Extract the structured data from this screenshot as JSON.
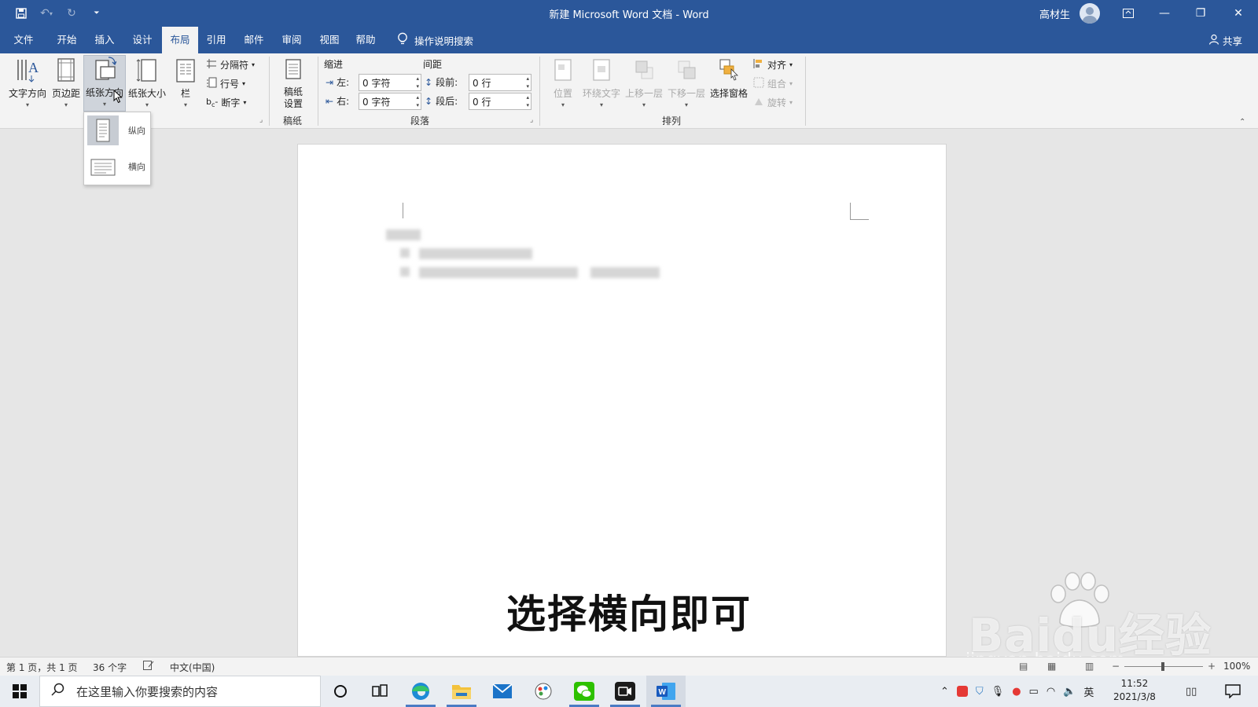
{
  "window": {
    "title": "新建 Microsoft Word 文档 - Word",
    "user_name": "高材生",
    "accent": "#2b579a"
  },
  "qat": {
    "save_icon": "save-icon",
    "undo_icon": "undo-icon",
    "redo_icon": "redo-icon",
    "customize_icon": "customize-qat-icon"
  },
  "tabs": [
    {
      "label": "文件"
    },
    {
      "label": "开始"
    },
    {
      "label": "插入"
    },
    {
      "label": "设计"
    },
    {
      "label": "布局",
      "active": true
    },
    {
      "label": "引用"
    },
    {
      "label": "邮件"
    },
    {
      "label": "审阅"
    },
    {
      "label": "视图"
    },
    {
      "label": "帮助"
    }
  ],
  "tell_me": "操作说明搜索",
  "share": "共享",
  "ribbon": {
    "page_setup": {
      "text_direction": "文字方向",
      "margins": "页边距",
      "orientation": "纸张方向",
      "size": "纸张大小",
      "columns": "栏",
      "breaks": "分隔符",
      "line_numbers": "行号",
      "hyphenation": "断字"
    },
    "manuscript": {
      "button": "稿纸\n设置",
      "button_line1": "稿纸",
      "button_line2": "设置",
      "group": "稿纸"
    },
    "paragraph": {
      "indent_header": "缩进",
      "spacing_header": "间距",
      "left_label": "左:",
      "left_value": "0 字符",
      "right_label": "右:",
      "right_value": "0 字符",
      "before_label": "段前:",
      "before_value": "0 行",
      "after_label": "段后:",
      "after_value": "0 行",
      "group": "段落"
    },
    "arrange": {
      "position": "位置",
      "wrap_text": "环绕文字",
      "bring_forward": "上移一层",
      "send_backward": "下移一层",
      "selection_pane": "选择窗格",
      "align": "对齐",
      "group_objects": "组合",
      "rotate": "旋转",
      "group": "排列"
    }
  },
  "orientation_menu": [
    {
      "label": "纵向",
      "selected": true
    },
    {
      "label": "横向",
      "selected": false
    }
  ],
  "overlay": {
    "subtitle": "选择横向即可",
    "watermark_main": "Baidu经验",
    "watermark_sub": "jingyan.baidu.com"
  },
  "status": {
    "page": "第 1 页，共 1 页",
    "words": "36 个字",
    "language": "中文(中国)",
    "zoom": "100%"
  },
  "taskbar": {
    "search_placeholder": "在这里输入你要搜索的内容",
    "ime": "英",
    "time": "11:52",
    "date": "2021/3/8"
  }
}
